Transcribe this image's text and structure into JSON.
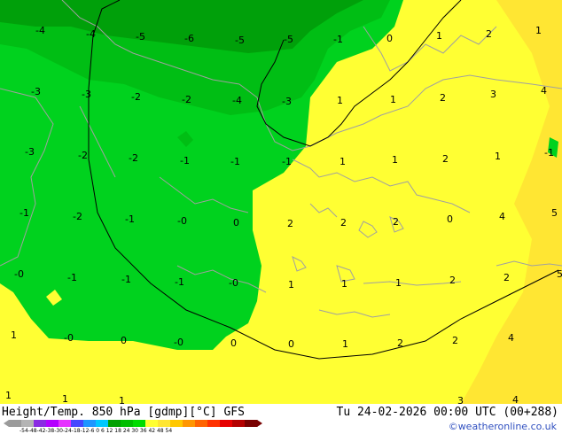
{
  "map": {
    "temperature_labels": [
      {
        "text": "-4"
      },
      {
        "text": "-4"
      },
      {
        "text": "-5"
      },
      {
        "text": "-6"
      },
      {
        "text": "-5"
      },
      {
        "text": "-5"
      },
      {
        "text": "-1"
      },
      {
        "text": "0"
      },
      {
        "text": "1"
      },
      {
        "text": "2"
      },
      {
        "text": "1"
      },
      {
        "text": "-3"
      },
      {
        "text": "-3"
      },
      {
        "text": "-2"
      },
      {
        "text": "-2"
      },
      {
        "text": "-4"
      },
      {
        "text": "-3"
      },
      {
        "text": "1"
      },
      {
        "text": "1"
      },
      {
        "text": "2"
      },
      {
        "text": "3"
      },
      {
        "text": "4"
      },
      {
        "text": "-3"
      },
      {
        "text": "-2"
      },
      {
        "text": "-2"
      },
      {
        "text": "-1"
      },
      {
        "text": "-1"
      },
      {
        "text": "-1"
      },
      {
        "text": "1"
      },
      {
        "text": "1"
      },
      {
        "text": "2"
      },
      {
        "text": "1"
      },
      {
        "text": "-1"
      },
      {
        "text": "-1"
      },
      {
        "text": "-2"
      },
      {
        "text": "-1"
      },
      {
        "text": "-0"
      },
      {
        "text": "0"
      },
      {
        "text": "2"
      },
      {
        "text": "2"
      },
      {
        "text": "2"
      },
      {
        "text": "0"
      },
      {
        "text": "4"
      },
      {
        "text": "5"
      },
      {
        "text": "-0"
      },
      {
        "text": "-1"
      },
      {
        "text": "-1"
      },
      {
        "text": "-1"
      },
      {
        "text": "-0"
      },
      {
        "text": "1"
      },
      {
        "text": "1"
      },
      {
        "text": "1"
      },
      {
        "text": "2"
      },
      {
        "text": "2"
      },
      {
        "text": "5"
      },
      {
        "text": "1"
      },
      {
        "text": "-0"
      },
      {
        "text": "0"
      },
      {
        "text": "-0"
      },
      {
        "text": "0"
      },
      {
        "text": "0"
      },
      {
        "text": "1"
      },
      {
        "text": "2"
      },
      {
        "text": "2"
      },
      {
        "text": "4"
      },
      {
        "text": "1"
      },
      {
        "text": "1"
      },
      {
        "text": "1"
      },
      {
        "text": "3"
      },
      {
        "text": "4"
      }
    ],
    "colors": {
      "yellow": "#ffff33",
      "light_green": "#00d21e",
      "mid_green": "#00be14",
      "dark_green": "#00a00a",
      "orange_yellow": "#ffe633",
      "contour": "#000000",
      "coastline": "#a0a0a0"
    }
  },
  "footer": {
    "title_left": "Height/Temp. 850 hPa [gdmp][°C] GFS",
    "title_right": "Tu 24-02-2026 00:00 UTC (00+288)",
    "credit": "©weatheronline.co.uk",
    "scale_ticks": "-54-48-42-38-30-24-18-12-6  0  6  12 18 24 30 36 42 48 54",
    "scale_colors": [
      "#9b9b9b",
      "#b4b4b4",
      "#8a2be2",
      "#b400ff",
      "#e632ff",
      "#4646ff",
      "#1e96ff",
      "#00c8ff",
      "#00a000",
      "#00be00",
      "#00dc00",
      "#ffff32",
      "#ffe632",
      "#ffc800",
      "#ff9600",
      "#ff6400",
      "#ff3200",
      "#e60000",
      "#b40000",
      "#780000"
    ]
  }
}
